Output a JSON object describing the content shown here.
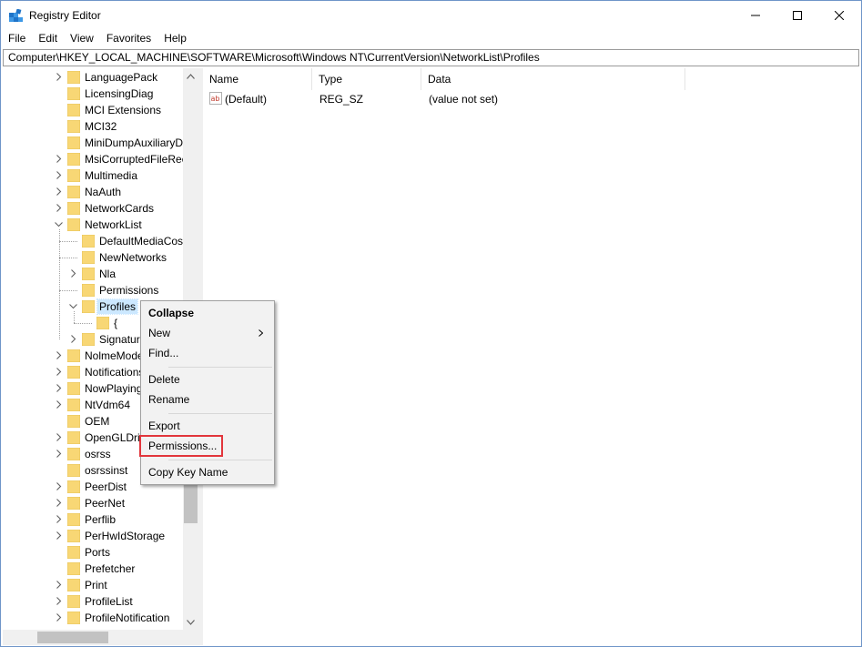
{
  "window": {
    "title": "Registry Editor"
  },
  "menu": [
    "File",
    "Edit",
    "View",
    "Favorites",
    "Help"
  ],
  "address": "Computer\\HKEY_LOCAL_MACHINE\\SOFTWARE\\Microsoft\\Windows NT\\CurrentVersion\\NetworkList\\Profiles",
  "tree": {
    "items": [
      {
        "label": "LanguagePack",
        "depth": 0,
        "expander": "collapsed"
      },
      {
        "label": "LicensingDiag",
        "depth": 0,
        "expander": "none"
      },
      {
        "label": "MCI Extensions",
        "depth": 0,
        "expander": "none"
      },
      {
        "label": "MCI32",
        "depth": 0,
        "expander": "none"
      },
      {
        "label": "MiniDumpAuxiliaryD",
        "depth": 0,
        "expander": "none"
      },
      {
        "label": "MsiCorruptedFileRec",
        "depth": 0,
        "expander": "collapsed"
      },
      {
        "label": "Multimedia",
        "depth": 0,
        "expander": "collapsed"
      },
      {
        "label": "NaAuth",
        "depth": 0,
        "expander": "collapsed"
      },
      {
        "label": "NetworkCards",
        "depth": 0,
        "expander": "collapsed"
      },
      {
        "label": "NetworkList",
        "depth": 0,
        "expander": "expanded"
      },
      {
        "label": "DefaultMediaCost",
        "depth": 1,
        "expander": "none"
      },
      {
        "label": "NewNetworks",
        "depth": 1,
        "expander": "none"
      },
      {
        "label": "Nla",
        "depth": 1,
        "expander": "collapsed"
      },
      {
        "label": "Permissions",
        "depth": 1,
        "expander": "none"
      },
      {
        "label": "Profiles",
        "depth": 1,
        "expander": "expanded",
        "selected": true
      },
      {
        "label": "{",
        "depth": 2,
        "expander": "none"
      },
      {
        "label": "Signatures",
        "depth": 1,
        "expander": "collapsed"
      },
      {
        "label": "NolmeModel",
        "depth": 0,
        "expander": "collapsed"
      },
      {
        "label": "Notifications",
        "depth": 0,
        "expander": "collapsed"
      },
      {
        "label": "NowPlaying",
        "depth": 0,
        "expander": "collapsed"
      },
      {
        "label": "NtVdm64",
        "depth": 0,
        "expander": "collapsed"
      },
      {
        "label": "OEM",
        "depth": 0,
        "expander": "none"
      },
      {
        "label": "OpenGLDrivers",
        "depth": 0,
        "expander": "collapsed"
      },
      {
        "label": "osrss",
        "depth": 0,
        "expander": "collapsed"
      },
      {
        "label": "osrssinst",
        "depth": 0,
        "expander": "none"
      },
      {
        "label": "PeerDist",
        "depth": 0,
        "expander": "collapsed"
      },
      {
        "label": "PeerNet",
        "depth": 0,
        "expander": "collapsed"
      },
      {
        "label": "Perflib",
        "depth": 0,
        "expander": "collapsed"
      },
      {
        "label": "PerHwIdStorage",
        "depth": 0,
        "expander": "collapsed"
      },
      {
        "label": "Ports",
        "depth": 0,
        "expander": "none"
      },
      {
        "label": "Prefetcher",
        "depth": 0,
        "expander": "none"
      },
      {
        "label": "Print",
        "depth": 0,
        "expander": "collapsed"
      },
      {
        "label": "ProfileList",
        "depth": 0,
        "expander": "collapsed"
      },
      {
        "label": "ProfileNotification",
        "depth": 0,
        "expander": "collapsed"
      }
    ]
  },
  "list": {
    "columns": [
      "Name",
      "Type",
      "Data"
    ],
    "rows": [
      {
        "name": "(Default)",
        "type": "REG_SZ",
        "data": "(value not set)"
      }
    ]
  },
  "context_menu": {
    "items": [
      {
        "label": "Collapse",
        "bold": true
      },
      {
        "label": "New",
        "submenu": true
      },
      {
        "label": "Find..."
      },
      {
        "label": "Delete"
      },
      {
        "label": "Rename"
      },
      {
        "label": "Export"
      },
      {
        "label": "Permissions...",
        "highlighted": true
      },
      {
        "label": "Copy Key Name"
      }
    ]
  },
  "colors": {
    "highlight_box": "#e2363c",
    "selection": "#cce8ff",
    "folder": "#f8d775"
  }
}
